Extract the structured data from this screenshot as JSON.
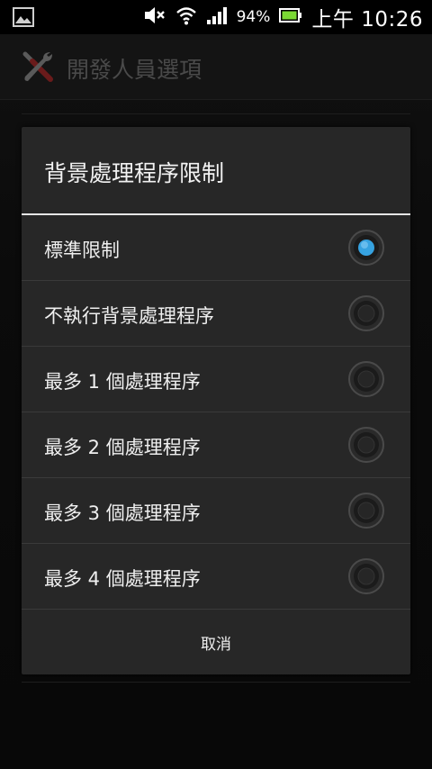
{
  "status_bar": {
    "battery_percent": "94%",
    "clock": "上午 10:26"
  },
  "action_bar": {
    "title": "開發人員選項",
    "icon": "tools-icon"
  },
  "dialog": {
    "title": "背景處理程序限制",
    "options": [
      {
        "label": "標準限制",
        "selected": true
      },
      {
        "label": "不執行背景處理程序",
        "selected": false
      },
      {
        "label": "最多 1 個處理程序",
        "selected": false
      },
      {
        "label": "最多 2 個處理程序",
        "selected": false
      },
      {
        "label": "最多 3 個處理程序",
        "selected": false
      },
      {
        "label": "最多 4 個處理程序",
        "selected": false
      }
    ],
    "cancel_label": "取消"
  },
  "colors": {
    "accent": "#36a2e0",
    "dialog_bg": "#272727",
    "divider": "#3a3a3a"
  }
}
